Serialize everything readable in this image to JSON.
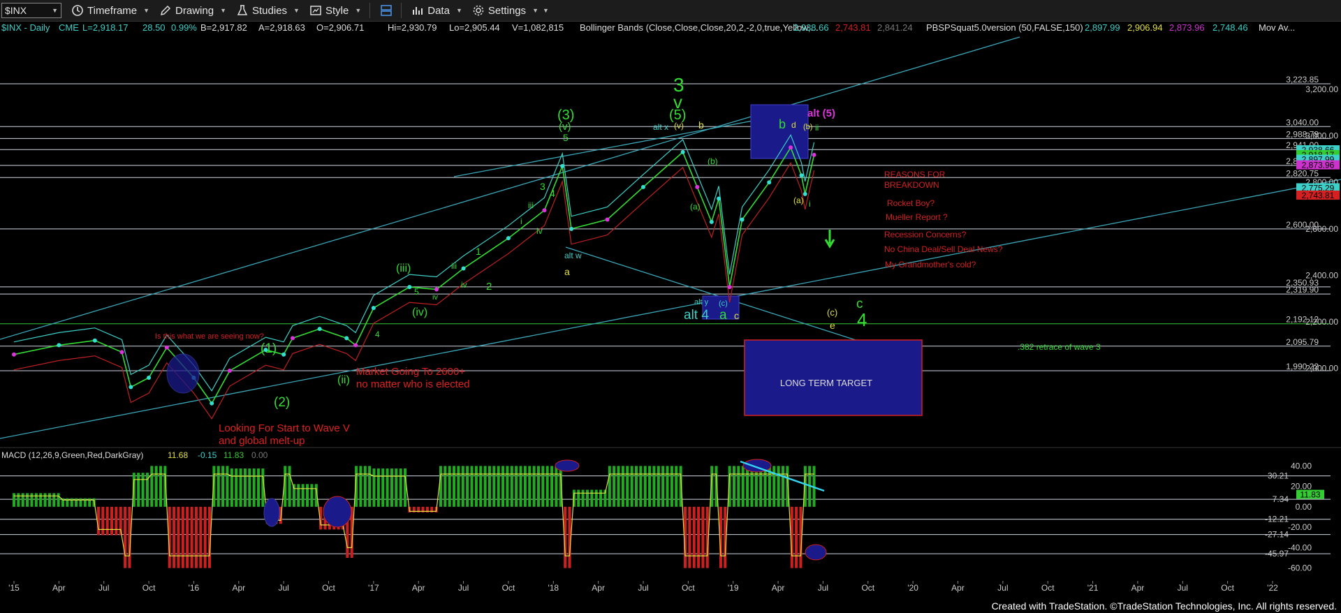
{
  "toolbar": {
    "symbol": "$INX",
    "items": [
      "Timeframe",
      "Drawing",
      "Studies",
      "Style",
      "Data",
      "Settings"
    ]
  },
  "header": {
    "symbol_info": "$INX - Daily",
    "exchange": "CME",
    "last": "L=2,918.17",
    "change": "28.50",
    "change_pct": "0.99%",
    "bid": "B=2,917.82",
    "ask": "A=2,918.63",
    "open": "O=2,906.71",
    "high": "Hi=2,930.79",
    "low": "Lo=2,905.44",
    "volume": "V=1,082,815",
    "bb_label": "Bollinger Bands (Close,Close,Close,20,2,-2,0,true,Yellow,...",
    "bb_values": [
      "2,938.66",
      "2,743.81",
      "2,841.24"
    ],
    "pbs_label": "PBSPSquat5.0version (50,FALSE,150)",
    "pbs_values": [
      "2,897.99",
      "2,906.94",
      "2,873.96",
      "2,748.46"
    ],
    "mov_label": "Mov Av..."
  },
  "price_levels": [
    "3,223.85",
    "3,040.00",
    "2,988.78",
    "2,941.00",
    "2,873.00",
    "2,820.75",
    "2,600.00",
    "2,350.93",
    "2,319.90",
    "2,192.12",
    "2,095.79",
    "1,990.22"
  ],
  "price_badges": [
    {
      "text": "2,938.66",
      "color": "#3cd0c8"
    },
    {
      "text": "2,918.17",
      "color": "#33cc33"
    },
    {
      "text": "2,897.99",
      "color": "#3cd0c8"
    },
    {
      "text": "2,873.96",
      "color": "#cc33cc"
    },
    {
      "text": "2,775.29",
      "color": "#3cd0c8"
    },
    {
      "text": "2,743.81",
      "color": "#d42020"
    }
  ],
  "annotations": {
    "wave_3_big": "3",
    "wave_v_big": "v",
    "wave_3_paren": "(3)",
    "wave_v_paren": "(v)",
    "wave_5_paren": "(5)",
    "alt_x": "alt x",
    "wave_v_small": "(v)",
    "wave_b": "b",
    "alt_5": "alt (5)",
    "wave_b_green": "b",
    "wave_d": "d",
    "wave_b_paren": "(b)",
    "wave_ii": "ii",
    "wave_b_small": "(b)",
    "wave_a_small": "(a)",
    "wave_a_yellow": "(a)",
    "wave_i": "i",
    "alt_w": "alt w",
    "wave_a_left": "a",
    "alt_y": "alt y",
    "wave_c_paren": "(c)",
    "alt_4": "alt 4",
    "wave_a_green": "a",
    "wave_c_small": "c",
    "wave_c_yellow": "(c)",
    "wave_e": "e",
    "wave_c_green": "c",
    "wave_4_big": "4",
    "wave_iii": "(iii)",
    "wave_iv": "(iv)",
    "wave_ii_paren": "(ii)",
    "wave_1_paren": "(1)",
    "wave_2_paren": "(2)",
    "wave_5_small": "5",
    "wave_3_small": "3",
    "wave_4_small": "4",
    "wave_iii_small": "iii",
    "wave_iv_small": "iv",
    "wave_i_small": "i",
    "wave_1": "1",
    "wave_2": "2",
    "wave_iii_2": "iii",
    "wave_iv_2": "iv",
    "wave_iv_3": "iv",
    "wave_4_2": "4",
    "wave_5_2": "5",
    "reasons_title": "REASONS FOR BREAKDOWN",
    "reasons": [
      "Rocket Boy?",
      "Mueller Report ?",
      "Recession Concerns?",
      "No China Deal/Sell Deal News?",
      "My Grandmother's cold?"
    ],
    "retrace": ".382 retrace of wave 3",
    "long_term_target": "LONG TERM TARGET",
    "is_this": "Is this what we are seeing now?",
    "market_going": "Market Going To 2600+",
    "no_matter": "no matter who is elected",
    "looking_for": "Looking For Start to Wave V",
    "global_meltup": "and global melt-up"
  },
  "macd": {
    "label": "MACD (12,26,9,Green,Red,DarkGray)",
    "values": [
      "11.68",
      "-0.15",
      "11.83",
      "0.00"
    ],
    "axis": [
      "40.00",
      "20.00",
      "0.00",
      "-20.00",
      "-40.00",
      "-60.00"
    ],
    "levels": [
      "30.21",
      "7.34",
      "-12.21",
      "-27.14",
      "-45.97"
    ],
    "badge": "11.83"
  },
  "chart_data": {
    "type": "line",
    "title": "$INX - Daily",
    "ylim": [
      1750,
      3350
    ],
    "yticks": [
      2000,
      2200,
      2400,
      2600,
      2800,
      3000,
      3200
    ],
    "ytick_labels": [
      "2,000.00",
      "2,200.00",
      "2,400.00",
      "2,600.00",
      "2,800.00",
      "3,000.00",
      "3,200.00"
    ],
    "x_ticks": [
      "'15",
      "Apr",
      "Jul",
      "Oct",
      "'16",
      "Apr",
      "Jul",
      "Oct",
      "'17",
      "Apr",
      "Jul",
      "Oct",
      "'18",
      "Apr",
      "Jul",
      "Oct",
      "'19",
      "Apr",
      "Jul",
      "Oct",
      "'20",
      "Apr",
      "Jul",
      "Oct",
      "'21",
      "Apr",
      "Jul",
      "Oct",
      "'22"
    ],
    "series": [
      {
        "values": [
          [
            2015.0,
            2060
          ],
          [
            2015.25,
            2100
          ],
          [
            2015.45,
            2120
          ],
          [
            2015.6,
            2070
          ],
          [
            2015.65,
            1920
          ],
          [
            2015.75,
            1960
          ],
          [
            2015.85,
            2090
          ],
          [
            2016.0,
            1960
          ],
          [
            2016.1,
            1850
          ],
          [
            2016.2,
            1990
          ],
          [
            2016.4,
            2080
          ],
          [
            2016.5,
            2060
          ],
          [
            2016.55,
            2130
          ],
          [
            2016.7,
            2170
          ],
          [
            2016.85,
            2130
          ],
          [
            2016.9,
            2100
          ],
          [
            2017.0,
            2260
          ],
          [
            2017.2,
            2350
          ],
          [
            2017.35,
            2340
          ],
          [
            2017.5,
            2430
          ],
          [
            2017.75,
            2560
          ],
          [
            2017.95,
            2680
          ],
          [
            2018.05,
            2870
          ],
          [
            2018.1,
            2600
          ],
          [
            2018.3,
            2640
          ],
          [
            2018.5,
            2780
          ],
          [
            2018.72,
            2930
          ],
          [
            2018.8,
            2780
          ],
          [
            2018.88,
            2630
          ],
          [
            2018.92,
            2730
          ],
          [
            2018.98,
            2350
          ],
          [
            2019.05,
            2640
          ],
          [
            2019.2,
            2800
          ],
          [
            2019.32,
            2950
          ],
          [
            2019.38,
            2830
          ],
          [
            2019.4,
            2750
          ],
          [
            2019.45,
            2918
          ]
        ]
      }
    ]
  }
}
